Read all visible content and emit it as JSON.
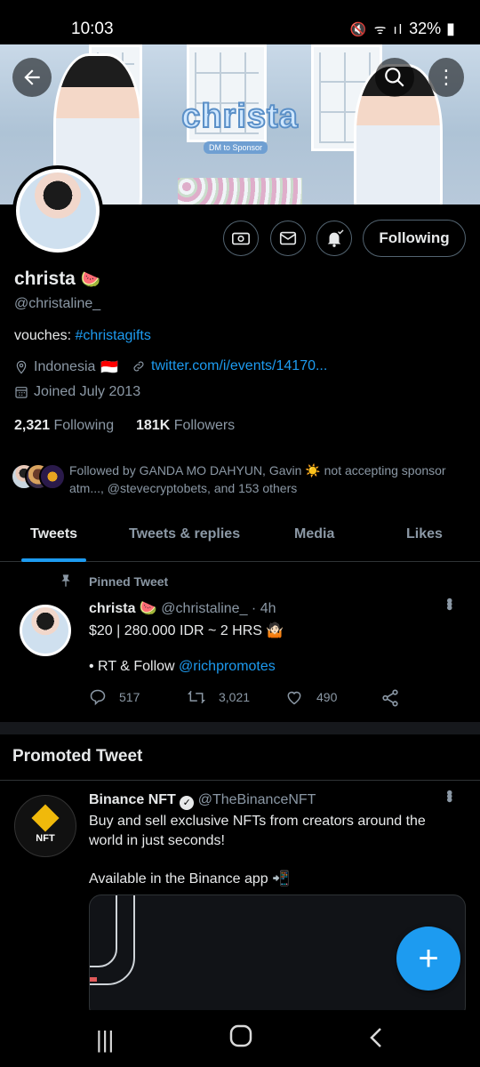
{
  "status_bar": {
    "time": "10:03",
    "battery": "32%",
    "icons": "mute-icon wifi-icon signal-icon battery-icon"
  },
  "banner": {
    "title": "christa",
    "subtitle": "DM to Sponsor"
  },
  "profile": {
    "name": "christa",
    "name_emoji": "🍉",
    "handle": "@christaline_",
    "bio_prefix": "vouches:",
    "bio_link": "#christagifts",
    "location": "Indonesia",
    "location_flag": "🇮🇩",
    "website": "twitter.com/i/events/14170...",
    "joined": "Joined July 2013",
    "following_count": "2,321",
    "following_label": "Following",
    "followers_count": "181K",
    "followers_label": "Followers",
    "followed_by": "Followed by GANDA MO DAHYUN, Gavin ☀️ not accepting sponsor atm..., @stevecryptobets, and 153 others",
    "follow_button": "Following"
  },
  "tabs": [
    {
      "label": "Tweets",
      "active": true
    },
    {
      "label": "Tweets & replies",
      "active": false
    },
    {
      "label": "Media",
      "active": false
    },
    {
      "label": "Likes",
      "active": false
    }
  ],
  "pinned_tweet": {
    "pinned_label": "Pinned Tweet",
    "author_name": "christa 🍉",
    "author_handle": "@christaline_",
    "time": "· 4h",
    "line1": "$20 | 280.000 IDR ~ 2 HRS 🤷🏻",
    "line2_prefix": "• RT & Follow",
    "line2_link": "@richpromotes",
    "replies": "517",
    "retweets": "3,021",
    "likes": "490"
  },
  "promoted": {
    "section_title": "Promoted Tweet",
    "author_name": "Binance NFT",
    "author_handle": "@TheBinanceNFT",
    "logo_label": "NFT",
    "text1": "Buy and sell exclusive NFTs from creators around the world in just seconds!",
    "text2": "Available in the Binance app 📲"
  },
  "colors": {
    "accent": "#1d9bf0",
    "background": "#000000",
    "muted": "#8b98a5",
    "binance": "#f0b90b"
  }
}
